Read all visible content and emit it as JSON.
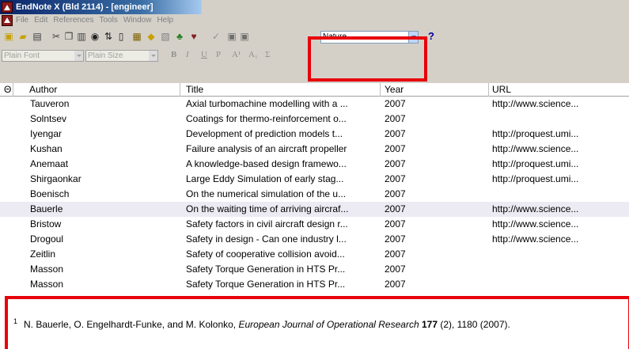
{
  "window": {
    "title": "EndNote X (Bld 2114) - [engineer]"
  },
  "menu": {
    "items": [
      "File",
      "Edit",
      "References",
      "Tools",
      "Window",
      "Help"
    ]
  },
  "toolbar": {
    "style_value": "Nature",
    "help_label": "?"
  },
  "format_bar": {
    "font": "Plain Font",
    "size": "Plain Size",
    "bold": "B",
    "italic": "I",
    "underline": "U",
    "plain": "P",
    "superscript": "A¹",
    "subscript": "A₁",
    "symbol": "Σ"
  },
  "table": {
    "columns": {
      "attach": "Θ",
      "author": "Author",
      "title": "Title",
      "year": "Year",
      "url": "URL"
    },
    "rows": [
      {
        "author": "Tauveron",
        "title": "Axial turbomachine modelling with a ...",
        "year": "2007",
        "url": "http://www.science..."
      },
      {
        "author": "Solntsev",
        "title": "Coatings for thermo-reinforcement o...",
        "year": "2007",
        "url": ""
      },
      {
        "author": "Iyengar",
        "title": "Development of prediction models t...",
        "year": "2007",
        "url": "http://proquest.umi..."
      },
      {
        "author": "Kushan",
        "title": "Failure analysis of an aircraft propeller",
        "year": "2007",
        "url": "http://www.science..."
      },
      {
        "author": "Anemaat",
        "title": "A knowledge-based design framewo...",
        "year": "2007",
        "url": "http://proquest.umi..."
      },
      {
        "author": "Shirgaonkar",
        "title": "Large Eddy Simulation of early stag...",
        "year": "2007",
        "url": "http://proquest.umi..."
      },
      {
        "author": "Boenisch",
        "title": "On the numerical simulation of the u...",
        "year": "2007",
        "url": ""
      },
      {
        "author": "Bauerle",
        "title": "On the waiting time of arriving aircraf...",
        "year": "2007",
        "url": "http://www.science...",
        "selected": true
      },
      {
        "author": "Bristow",
        "title": "Safety factors in civil aircraft design r...",
        "year": "2007",
        "url": "http://www.science..."
      },
      {
        "author": "Drogoul",
        "title": "Safety in design - Can one industry l...",
        "year": "2007",
        "url": "http://www.science..."
      },
      {
        "author": "Zeitlin",
        "title": "Safety of cooperative collision avoid...",
        "year": "2007",
        "url": ""
      },
      {
        "author": "Masson",
        "title": "Safety Torque Generation in HTS Pr...",
        "year": "2007",
        "url": ""
      },
      {
        "author": "Masson",
        "title": "Safety Torque Generation in HTS Pr...",
        "year": "2007",
        "url": ""
      }
    ]
  },
  "preview": {
    "number": "1",
    "authors": "N. Bauerle, O. Engelhardt-Funke, and M. Kolonko, ",
    "journal": "European Journal of Operational Research",
    "volume": "177",
    "rest": " (2), 1180 (2007)."
  },
  "colors": {
    "highlight": "#e8000b",
    "selected_row": "#ecebf3"
  }
}
